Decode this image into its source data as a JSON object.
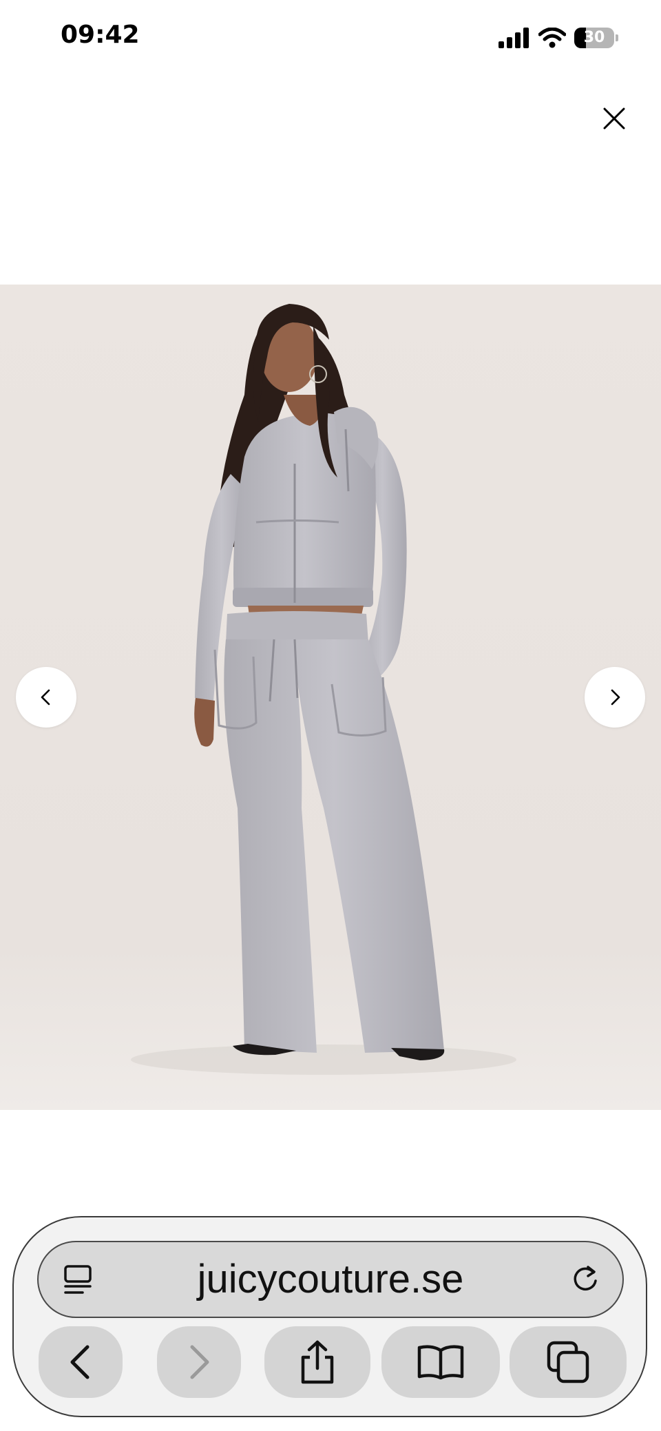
{
  "status_bar": {
    "time": "09:42",
    "battery_level": "30",
    "icons": [
      "signal-icon",
      "wifi-icon",
      "battery-icon"
    ]
  },
  "overlay": {
    "close_icon": "close-icon"
  },
  "gallery": {
    "image_alt": "Model wearing a grey velour zip hoodie and matching wide-leg pants",
    "prev_icon": "chevron-left-icon",
    "next_icon": "chevron-right-icon",
    "background_color": "#ebe5e1"
  },
  "browser": {
    "url": "juicycouture.se",
    "reader_icon": "page-menu-icon",
    "reload_icon": "reload-icon",
    "toolbar": [
      "back-icon",
      "forward-icon",
      "share-icon",
      "bookmarks-icon",
      "tabs-icon"
    ]
  }
}
